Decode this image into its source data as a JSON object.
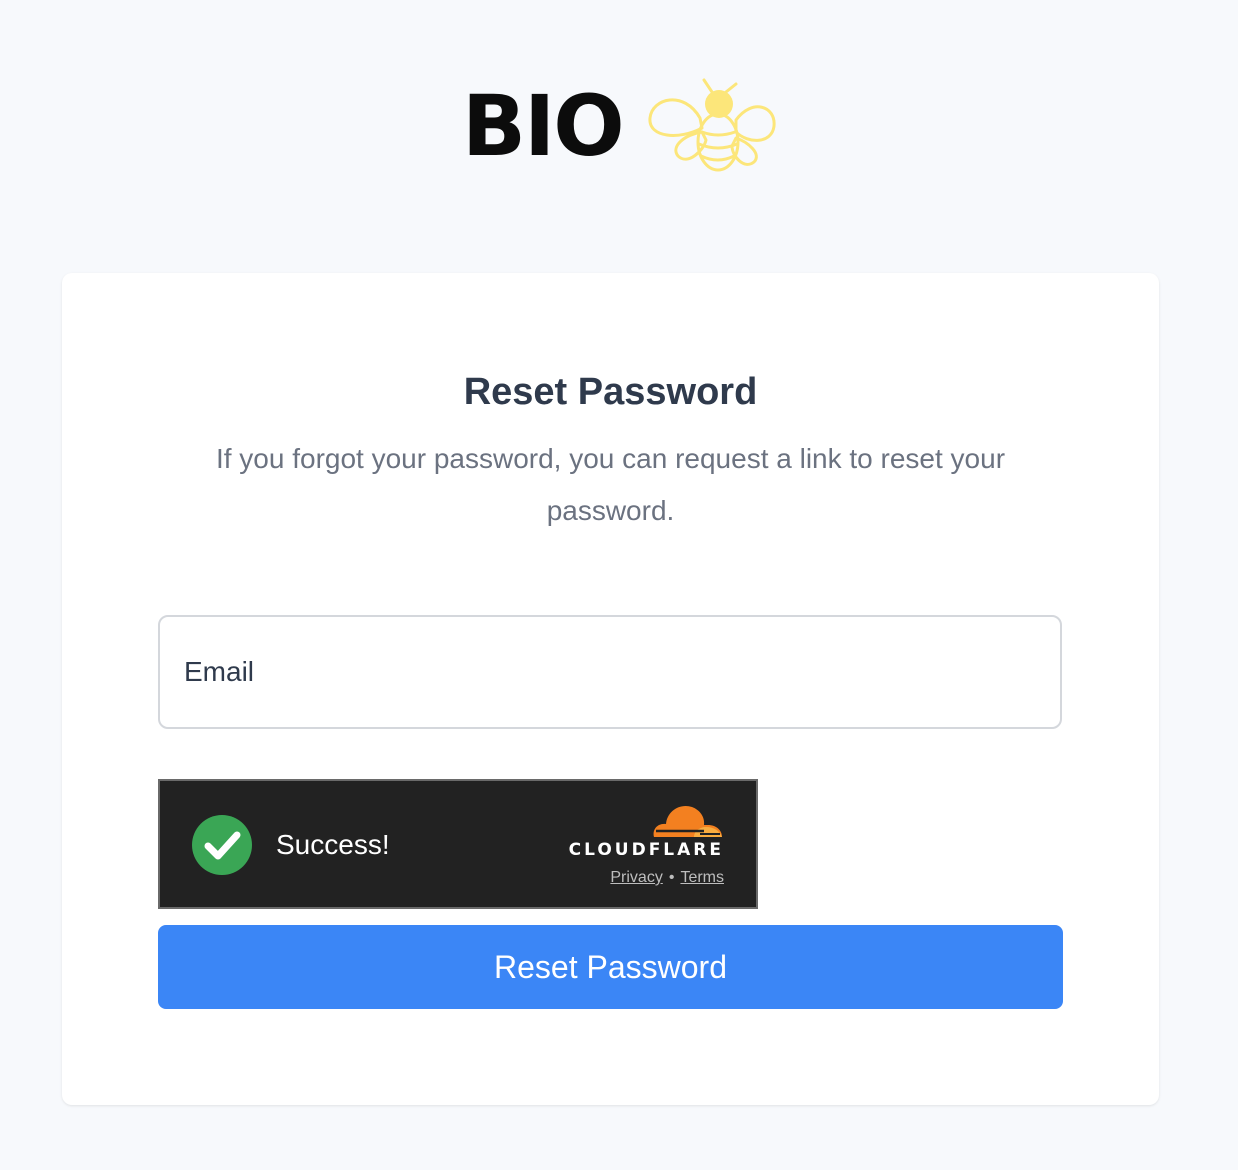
{
  "logo": {
    "text": "BIO",
    "icon": "bee-icon"
  },
  "card": {
    "title": "Reset Password",
    "subtitle": "If you forgot your password, you can request a link to reset your password."
  },
  "email": {
    "placeholder": "Email",
    "value": ""
  },
  "turnstile": {
    "status_icon": "check-circle-icon",
    "status": "Success!",
    "brand": "CLOUDFLARE",
    "brand_icon": "cloudflare-cloud-icon",
    "privacy_label": "Privacy",
    "separator": "•",
    "terms_label": "Terms"
  },
  "submit": {
    "label": "Reset Password"
  },
  "colors": {
    "background": "#f7f9fc",
    "card": "#ffffff",
    "title": "#2f3a4c",
    "subtitle": "#6b7280",
    "button": "#3b86f6",
    "turnstile_bg": "#222222",
    "success": "#3aa655",
    "cloudflare_orange": "#f38020",
    "bee_yellow": "#fce67a"
  }
}
